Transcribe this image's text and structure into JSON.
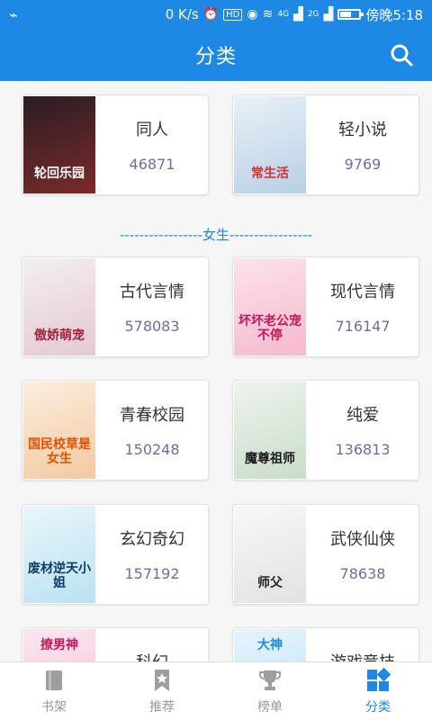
{
  "status_bar": {
    "usb_icon": "usb-icon",
    "network_speed": "0 K/s",
    "network_type_1": "4G",
    "network_type_2": "2G",
    "time": "傍晚5:18"
  },
  "app_bar": {
    "title": "分类",
    "search_icon": "search-icon"
  },
  "section_female": {
    "label": "-----------------女生-----------------"
  },
  "categories": [
    {
      "name": "同人",
      "count": "46871",
      "cover_text": "轮回乐园",
      "cover_colors": [
        "#2a1d24",
        "#7b2a2a"
      ]
    },
    {
      "name": "轻小说",
      "count": "9769",
      "cover_text": "常生活",
      "cover_colors": [
        "#e8f1f7",
        "#b9cfe4"
      ]
    },
    {
      "name": "古代言情",
      "count": "578083",
      "cover_text": "傲娇萌宠",
      "cover_colors": [
        "#f4eef0",
        "#e3c9d2"
      ]
    },
    {
      "name": "现代言情",
      "count": "716147",
      "cover_text": "坏坏老公宠不停",
      "cover_colors": [
        "#fbe3ec",
        "#f5b9cc"
      ]
    },
    {
      "name": "青春校园",
      "count": "150248",
      "cover_text": "国民校草是女生",
      "cover_colors": [
        "#fbeedd",
        "#f2c9a3"
      ]
    },
    {
      "name": "纯爱",
      "count": "136813",
      "cover_text": "魔尊祖师",
      "cover_colors": [
        "#eef4ee",
        "#c9dcc9"
      ]
    },
    {
      "name": "玄幻奇幻",
      "count": "157192",
      "cover_text": "废材逆天小姐",
      "cover_colors": [
        "#e9f6fb",
        "#b9e2f1"
      ]
    },
    {
      "name": "武侠仙侠",
      "count": "78638",
      "cover_text": "师父",
      "cover_colors": [
        "#f7f7f7",
        "#e2e2e2"
      ]
    },
    {
      "name": "科幻",
      "count": "",
      "cover_text": "撩男神",
      "cover_colors": [
        "#fde6ef",
        "#f7c2d6"
      ]
    },
    {
      "name": "游戏竞技",
      "count": "",
      "cover_text": "大神",
      "cover_colors": [
        "#e6f4fc",
        "#bfe2f7"
      ]
    }
  ],
  "bottom_nav": [
    {
      "label": "书架",
      "icon": "bookshelf-icon",
      "active": false
    },
    {
      "label": "推荐",
      "icon": "recommend-icon",
      "active": false
    },
    {
      "label": "榜单",
      "icon": "trophy-icon",
      "active": false
    },
    {
      "label": "分类",
      "icon": "category-icon",
      "active": true
    }
  ],
  "colors": {
    "primary": "#1e88e5",
    "count_text": "#6a6fa0",
    "nav_inactive": "#999999"
  }
}
